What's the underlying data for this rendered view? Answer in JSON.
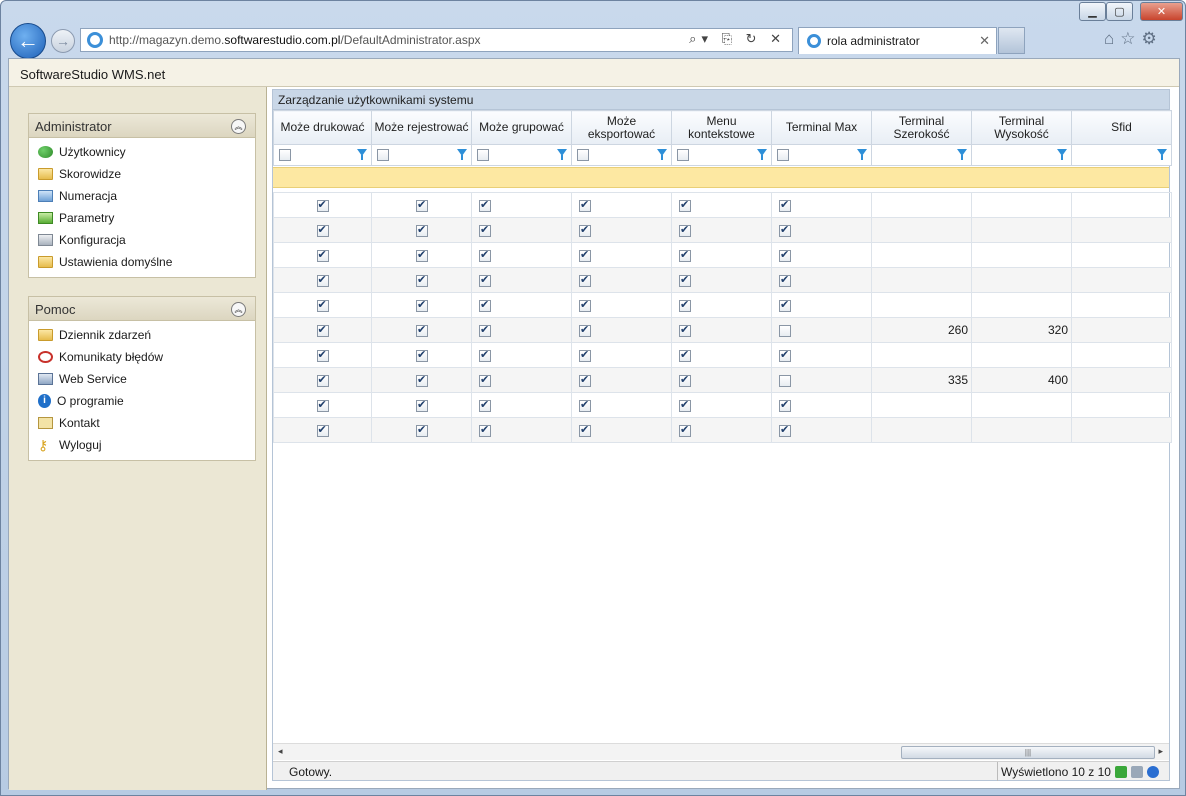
{
  "browser": {
    "url_prefix": "http://magazyn.demo.",
    "url_domain": "softwarestudio.com.pl",
    "url_path": "/DefaultAdministrator.aspx",
    "tab_title": "rola administrator",
    "tab_close": "✕",
    "addr_tools": "⌕▾ ⎘ ↻ ✕",
    "right_tools": "⌂☆⚙",
    "back": "←",
    "forward": "→"
  },
  "window": {
    "minimize": "▁",
    "maximize": "▢",
    "close": "✕"
  },
  "app": {
    "title": "SoftwareStudio WMS.net"
  },
  "sidebar": {
    "admin": {
      "title": "Administrator",
      "items": [
        {
          "label": "Użytkownicy",
          "icon": "users-icon"
        },
        {
          "label": "Skorowidze",
          "icon": "folder-icon"
        },
        {
          "label": "Numeracja",
          "icon": "folder-blue-icon"
        },
        {
          "label": "Parametry",
          "icon": "folder-green-icon"
        },
        {
          "label": "Konfiguracja",
          "icon": "folder-gray-icon"
        },
        {
          "label": "Ustawienia domyślne",
          "icon": "folder-icon"
        }
      ]
    },
    "help": {
      "title": "Pomoc",
      "items": [
        {
          "label": "Dziennik zdarzeń",
          "icon": "log-icon"
        },
        {
          "label": "Komunikaty błędów",
          "icon": "error-icon"
        },
        {
          "label": "Web Service",
          "icon": "web-service-icon"
        },
        {
          "label": "O programie",
          "icon": "info-icon"
        },
        {
          "label": "Kontakt",
          "icon": "mail-icon"
        },
        {
          "label": "Wyloguj",
          "icon": "key-icon"
        }
      ]
    }
  },
  "grid": {
    "title": "Zarządzanie użytkownikami systemu",
    "columns": [
      "Może drukować",
      "Może rejestrować",
      "Może grupować",
      "Może eksportować",
      "Menu kontekstowe",
      "Terminal Max",
      "Terminal Szerokość",
      "Terminal Wysokość",
      "Sfid"
    ],
    "rows": [
      {
        "flags": [
          true,
          true,
          true,
          true,
          true,
          true
        ],
        "szerokosc": "",
        "wysokosc": "",
        "sfid": ""
      },
      {
        "flags": [
          true,
          true,
          true,
          true,
          true,
          true
        ],
        "szerokosc": "",
        "wysokosc": "",
        "sfid": ""
      },
      {
        "flags": [
          true,
          true,
          true,
          true,
          true,
          true
        ],
        "szerokosc": "",
        "wysokosc": "",
        "sfid": ""
      },
      {
        "flags": [
          true,
          true,
          true,
          true,
          true,
          true
        ],
        "szerokosc": "",
        "wysokosc": "",
        "sfid": ""
      },
      {
        "flags": [
          true,
          true,
          true,
          true,
          true,
          true
        ],
        "szerokosc": "",
        "wysokosc": "",
        "sfid": ""
      },
      {
        "flags": [
          true,
          true,
          true,
          true,
          true,
          false
        ],
        "szerokosc": "260",
        "wysokosc": "320",
        "sfid": "",
        "selected_col": 5
      },
      {
        "flags": [
          true,
          true,
          true,
          true,
          true,
          true
        ],
        "szerokosc": "",
        "wysokosc": "",
        "sfid": ""
      },
      {
        "flags": [
          true,
          true,
          true,
          true,
          true,
          false
        ],
        "szerokosc": "335",
        "wysokosc": "400",
        "sfid": ""
      },
      {
        "flags": [
          true,
          true,
          true,
          true,
          true,
          true
        ],
        "szerokosc": "",
        "wysokosc": "",
        "sfid": ""
      },
      {
        "flags": [
          true,
          true,
          true,
          true,
          true,
          true
        ],
        "szerokosc": "",
        "wysokosc": "",
        "sfid": ""
      }
    ],
    "scroll_grip": "|||"
  },
  "status": {
    "left": "Gotowy.",
    "right": "Wyświetlono 10 z 10"
  }
}
